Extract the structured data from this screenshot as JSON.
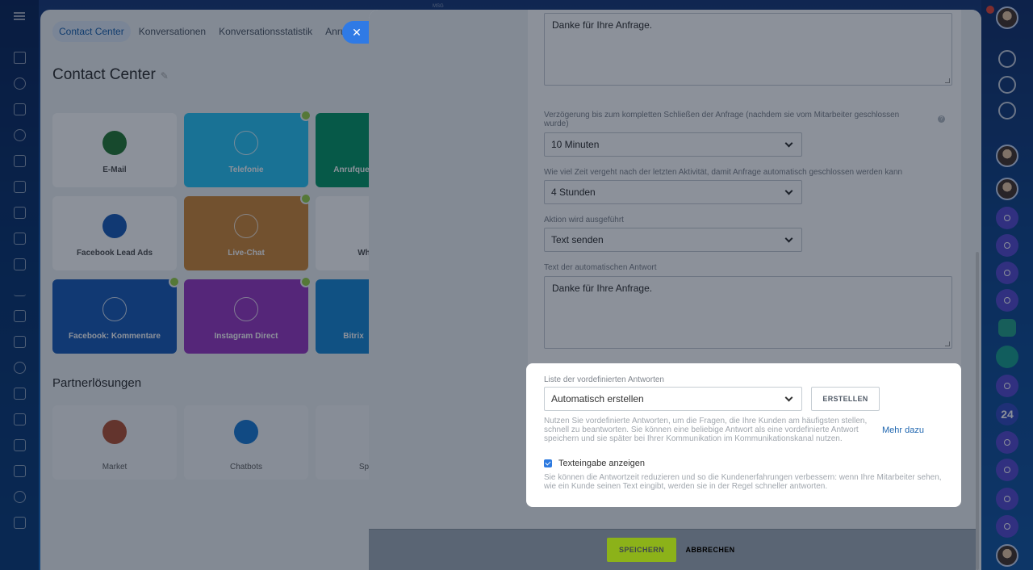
{
  "window": {
    "top_mark": "MSG"
  },
  "background_page": {
    "tabs": [
      "Contact Center",
      "Konversationen",
      "Konversationsstatistik",
      "Anru"
    ],
    "title": "Contact Center",
    "tiles": [
      {
        "label": "E-Mail",
        "color": "#ffffff",
        "icon": "mail-icon"
      },
      {
        "label": "Telefonie",
        "color": "#2fc6f6",
        "icon": "phone-icon"
      },
      {
        "label": "Anrufquelle",
        "color": "#0c9a6b",
        "icon": "callback-icon"
      },
      {
        "label": "Facebook Lead Ads",
        "color": "#ffffff",
        "icon": "facebook-leads-icon"
      },
      {
        "label": "Live-Chat",
        "color": "#cf8a3d",
        "icon": "chat-icon"
      },
      {
        "label": "Wh",
        "color": "#ffffff",
        "icon": "whatsapp-icon"
      },
      {
        "label": "Facebook: Kommentare",
        "color": "#1f5fb8",
        "icon": "facebook-comments-icon"
      },
      {
        "label": "Instagram Direct",
        "color": "#9b3cc3",
        "icon": "instagram-icon"
      },
      {
        "label": "Bitrix",
        "color": "#1e8ad6",
        "icon": "bitrix-icon"
      }
    ],
    "partner_section": "Partnerlösungen",
    "partners": [
      {
        "label": "Market",
        "color": "#b5563a"
      },
      {
        "label": "Chatbots",
        "color": "#1f7fd6"
      },
      {
        "label": "Sp",
        "color": "#1e8ad6"
      }
    ]
  },
  "form": {
    "auto_reply_top_text": "Danke für Ihre Anfrage.",
    "close_delay_label": "Verzögerung bis zum kompletten Schließen der Anfrage (nachdem sie vom Mitarbeiter geschlossen wurde)",
    "close_delay_value": "10 Minuten",
    "inactivity_label": "Wie viel Zeit vergeht nach der letzten Aktivität, damit Anfrage automatisch geschlossen werden kann",
    "inactivity_value": "4 Stunden",
    "action_label": "Aktion wird ausgeführt",
    "action_value": "Text senden",
    "auto_reply_label": "Text der automatischen Antwort",
    "auto_reply_text": "Danke für Ihre Anfrage.",
    "help_glyph": "?"
  },
  "highlight": {
    "list_label": "Liste der vordefinierten Antworten",
    "list_value": "Automatisch erstellen",
    "create_button": "ERSTELLEN",
    "description": "Nutzen Sie vordefinierte Antworten, um die Fragen, die Ihre Kunden am häufigsten stellen, schnell zu beantworten. Sie können eine beliebige Antwort als eine vordefinierte Antwort speichern und sie später bei Ihrer Kommunikation im Kommunikationskanal nutzen.",
    "more_link": "Mehr dazu",
    "typing_checkbox_label": "Texteingabe anzeigen",
    "typing_checked": true,
    "typing_description": "Sie können die Antwortzeit reduzieren und so die Kundenerfahrungen verbessern: wenn Ihre Mitarbeiter sehen, wie ein Kunde seinen Text eingibt, werden sie in der Regel schneller antworten."
  },
  "footer": {
    "save": "SPEICHERN",
    "cancel": "ABBRECHEN"
  },
  "close_glyph": "✕",
  "right_rail": {
    "counter": "24"
  },
  "colors": {
    "accent": "#2f7ae5",
    "save": "#bbed21",
    "link": "#2067b0"
  }
}
